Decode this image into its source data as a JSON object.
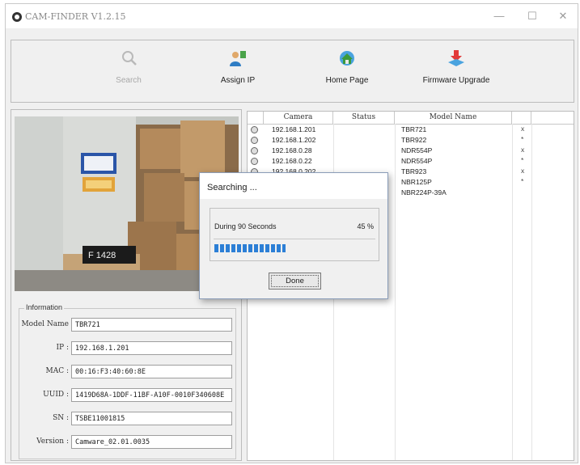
{
  "window": {
    "title": "CAM-FINDER V1.2.15"
  },
  "toolbar": {
    "search_label": "Search",
    "assign_ip_label": "Assign IP",
    "home_page_label": "Home Page",
    "firmware_upgrade_label": "Firmware Upgrade"
  },
  "camera_view": {
    "sign_text": "F 1428"
  },
  "info": {
    "legend": "Information",
    "fields": [
      {
        "label": "Model Name",
        "value": "TBR721"
      },
      {
        "label": "IP :",
        "value": "192.168.1.201"
      },
      {
        "label": "MAC :",
        "value": "00:16:F3:40:60:8E"
      },
      {
        "label": "UUID :",
        "value": "1419D68A-1DDF-11BF-A10F-0010F340608E"
      },
      {
        "label": "SN :",
        "value": "TSBE11001815"
      },
      {
        "label": "Version :",
        "value": "Camware_02.01.0035"
      }
    ]
  },
  "camera_list": {
    "columns": [
      "Camera",
      "Status",
      "Model Name"
    ],
    "rows": [
      {
        "ip": "192.168.1.201",
        "model": "TBR721",
        "mark": "x"
      },
      {
        "ip": "192.168.1.202",
        "model": "TBR922",
        "mark": "*"
      },
      {
        "ip": "192.168.0.28",
        "model": "NDR554P",
        "mark": "x"
      },
      {
        "ip": "192.168.0.22",
        "model": "NDR554P",
        "mark": "*"
      },
      {
        "ip": "192.168.0.202",
        "model": "TBR923",
        "mark": "x"
      },
      {
        "ip": "",
        "model": "NBR125P",
        "mark": "*"
      },
      {
        "ip": "",
        "model": "NBR224P-39A",
        "mark": ""
      }
    ]
  },
  "dialog": {
    "title": "Searching ...",
    "message": "During 90 Seconds",
    "percent_text": "45 %",
    "progress": 0.45,
    "done_label": "Done"
  },
  "colors": {
    "progress": "#2c7fd6",
    "icon_blue": "#4aa3df",
    "icon_red": "#e23a3a"
  }
}
